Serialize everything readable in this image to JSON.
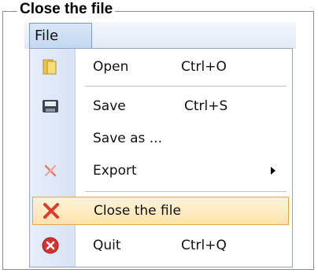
{
  "group": {
    "legend": "Close the file"
  },
  "menubar": {
    "file_label": "File"
  },
  "menu": {
    "open": {
      "label": "Open",
      "shortcut": "Ctrl+O",
      "icon": "folder-icon"
    },
    "save": {
      "label": "Save",
      "shortcut": "Ctrl+S",
      "icon": "save-icon"
    },
    "save_as": {
      "label": "Save as ..."
    },
    "export": {
      "label": "Export",
      "icon": "export-icon",
      "has_submenu": true
    },
    "close": {
      "label": "Close the file",
      "icon": "close-icon",
      "highlighted": true
    },
    "quit": {
      "label": "Quit",
      "shortcut": "Ctrl+Q",
      "icon": "quit-icon"
    }
  },
  "colors": {
    "highlight_border": "#e2a64b",
    "highlight_fill": "#fde3ac",
    "menu_border": "#8ea6c4",
    "close_red": "#e03a32"
  }
}
